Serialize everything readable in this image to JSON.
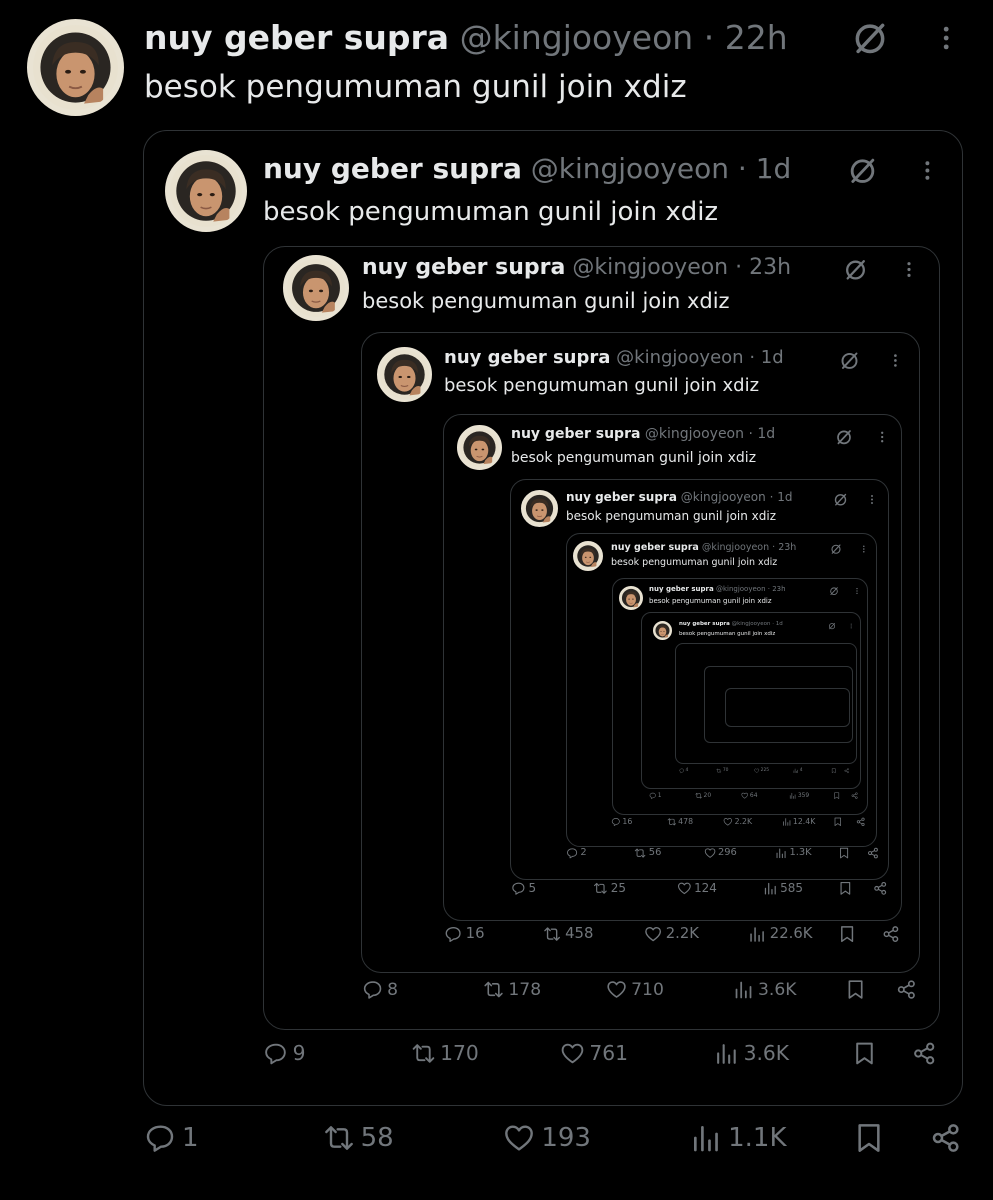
{
  "text": "besok pengumuman gunil join xdiz",
  "posts": [
    {
      "name": "nuy geber supra",
      "handle": "@kingjooyeon",
      "separator": "·",
      "time": "22h",
      "actions": {
        "replies": "1",
        "reposts": "58",
        "likes": "193",
        "views": "1.1K"
      }
    },
    {
      "name": "nuy geber supra",
      "handle": "@kingjooyeon",
      "separator": "·",
      "time": "1d",
      "actions": {
        "replies": "9",
        "reposts": "170",
        "likes": "761",
        "views": "3.6K"
      }
    },
    {
      "name": "nuy geber supra",
      "handle": "@kingjooyeon",
      "separator": "·",
      "time": "23h",
      "actions": {
        "replies": "8",
        "reposts": "178",
        "likes": "710",
        "views": "3.6K"
      }
    },
    {
      "name": "nuy geber supra",
      "handle": "@kingjooyeon",
      "separator": "·",
      "time": "1d",
      "actions": {
        "replies": "16",
        "reposts": "458",
        "likes": "2.2K",
        "views": "22.6K"
      }
    },
    {
      "name": "nuy geber supra",
      "handle": "@kingjooyeon",
      "separator": "·",
      "time": "1d",
      "actions": {
        "replies": "5",
        "reposts": "25",
        "likes": "124",
        "views": "585"
      }
    },
    {
      "name": "nuy geber supra",
      "handle": "@kingjooyeon",
      "separator": "·",
      "time": "1d",
      "actions": {
        "replies": "2",
        "reposts": "56",
        "likes": "296",
        "views": "1.3K"
      }
    },
    {
      "name": "nuy geber supra",
      "handle": "@kingjooyeon",
      "separator": "·",
      "time": "23h",
      "actions": {
        "replies": "16",
        "reposts": "478",
        "likes": "2.2K",
        "views": "12.4K"
      }
    },
    {
      "name": "nuy geber supra",
      "handle": "@kingjooyeon",
      "separator": "·",
      "time": "23h",
      "actions": {
        "replies": "1",
        "reposts": "20",
        "likes": "64",
        "views": "359"
      }
    },
    {
      "name": "nuy geber supra",
      "handle": "@kingjooyeon",
      "separator": "·",
      "time": "1d",
      "actions": {
        "replies": "4",
        "reposts": "70",
        "likes": "225",
        "views": "4"
      }
    }
  ],
  "icons": {
    "premium": "circle-slash-icon",
    "more": "more-vertical-icon",
    "reply": "comment-icon",
    "repost": "repost-icon",
    "like": "heart-icon",
    "views": "bar-chart-icon",
    "bookmark": "bookmark-icon",
    "share": "share-icon"
  },
  "colors": {
    "background": "#000000",
    "text": "#e7e9ea",
    "muted": "#71767b",
    "border": "#2f3336"
  }
}
